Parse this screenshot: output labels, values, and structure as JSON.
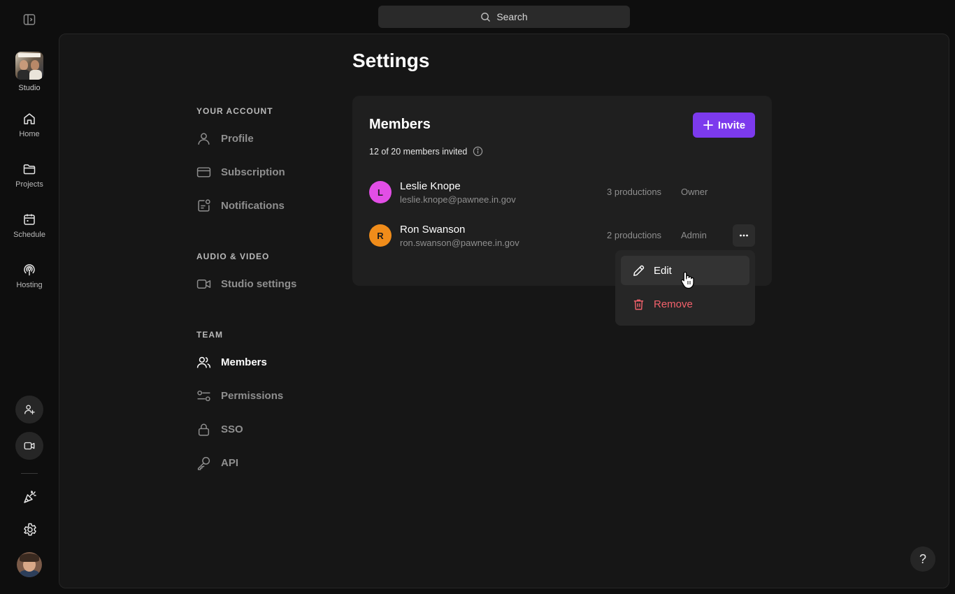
{
  "rail": {
    "studio_label": "Studio",
    "nav": [
      {
        "label": "Home",
        "icon": "home-icon"
      },
      {
        "label": "Projects",
        "icon": "folder-icon"
      },
      {
        "label": "Schedule",
        "icon": "calendar-icon"
      },
      {
        "label": "Hosting",
        "icon": "broadcast-icon"
      }
    ]
  },
  "search": {
    "placeholder": "Search"
  },
  "page": {
    "title": "Settings"
  },
  "settings_nav": {
    "sections": [
      {
        "heading": "YOUR ACCOUNT",
        "items": [
          "Profile",
          "Subscription",
          "Notifications"
        ]
      },
      {
        "heading": "AUDIO & VIDEO",
        "items": [
          "Studio settings"
        ]
      },
      {
        "heading": "TEAM",
        "items": [
          "Members",
          "Permissions",
          "SSO",
          "API"
        ]
      }
    ],
    "active": "Members"
  },
  "members_card": {
    "title": "Members",
    "invite_label": "Invite",
    "count_text": "12 of 20 members invited",
    "members": [
      {
        "initial": "L",
        "name": "Leslie Knope",
        "email": "leslie.knope@pawnee.in.gov",
        "productions": "3 productions",
        "role": "Owner",
        "color": "#e24ee6"
      },
      {
        "initial": "R",
        "name": "Ron Swanson",
        "email": "ron.swanson@pawnee.in.gov",
        "productions": "2 productions",
        "role": "Admin",
        "color": "#f08c1a"
      }
    ]
  },
  "row_menu": {
    "edit": "Edit",
    "remove": "Remove"
  },
  "help": {
    "label": "?"
  },
  "colors": {
    "accent": "#7c3aed",
    "danger": "#f2616b"
  }
}
